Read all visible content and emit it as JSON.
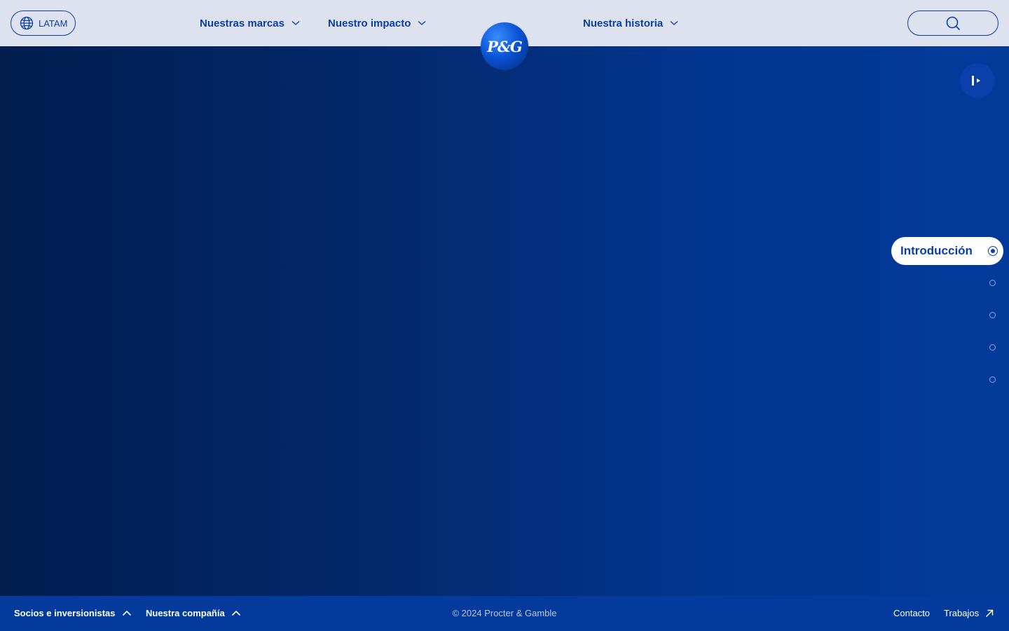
{
  "header": {
    "region_label": "LATAM",
    "nav": [
      {
        "label": "Nuestras marcas"
      },
      {
        "label": "Nuestro impacto"
      },
      {
        "label": "Nuestra historia"
      }
    ],
    "logo_text": "P&G"
  },
  "sections": {
    "active_label": "Introducción",
    "inactive_count": 4
  },
  "footer": {
    "left_links": [
      {
        "label": "Socios e inversionistas"
      },
      {
        "label": "Nuestra compañía"
      }
    ],
    "copyright": "© 2024 Procter & Gamble",
    "right_links": [
      {
        "label": "Contacto"
      },
      {
        "label": "Trabajos"
      }
    ]
  },
  "colors": {
    "brand_blue": "#0a3ea8",
    "header_bg": "#dde2ee",
    "footer_bg": "#033a9c"
  },
  "icons": {
    "region": "globe-icon",
    "nav_chevron": "chevron-down-icon",
    "search": "search-icon",
    "video_control": "play-icon",
    "footer_chevron": "chevron-up-icon",
    "external": "external-arrow-icon"
  }
}
